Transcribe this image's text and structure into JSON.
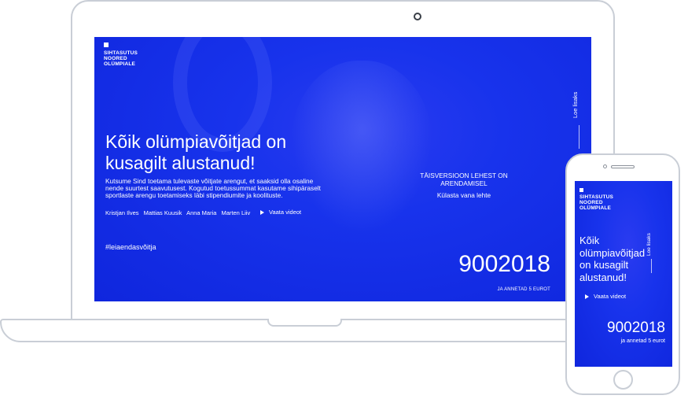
{
  "logo": {
    "lines": [
      "SIHTASUTUS",
      "NOORED",
      "OLÜMPIALE"
    ]
  },
  "desktop": {
    "headline": "Kõik olümpiavõitjad on kusagilt alustanud!",
    "intro": "Kutsume Sind toetama tulevaste võitjate arengut, et saaksid olla osaline nende suurtest saavutusest. Kogutud toetussummat kasutame sihipäraselt sportlaste arengu toetamiseks läbi stipendiumite ja koolituste.",
    "athletes": [
      "Kristjan Ilves",
      "Mattias Kuusik",
      "Anna Maria",
      "Marten Liiv"
    ],
    "video_label": "Vaata videot",
    "hashtag": "#leiaendasvõitja",
    "notice_title": "TÄISVERSIOON LEHEST ON ARENDAMISEL",
    "notice_link": "Külasta vana lehte",
    "side_link": "Loe lisaks",
    "counter": "9002018",
    "counter_caption": "JA ANNETAD 5 EUROT"
  },
  "mobile": {
    "headline": "Kõik olümpiavõitjad on kusagilt alustanud!",
    "side_link": "Loe lisaks",
    "video_label": "Vaata videot",
    "counter": "9002018",
    "counter_caption": "ja annetad 5 eurot"
  },
  "colors": {
    "brand_blue": "#1833ec",
    "device_outline": "#c9ced6"
  }
}
